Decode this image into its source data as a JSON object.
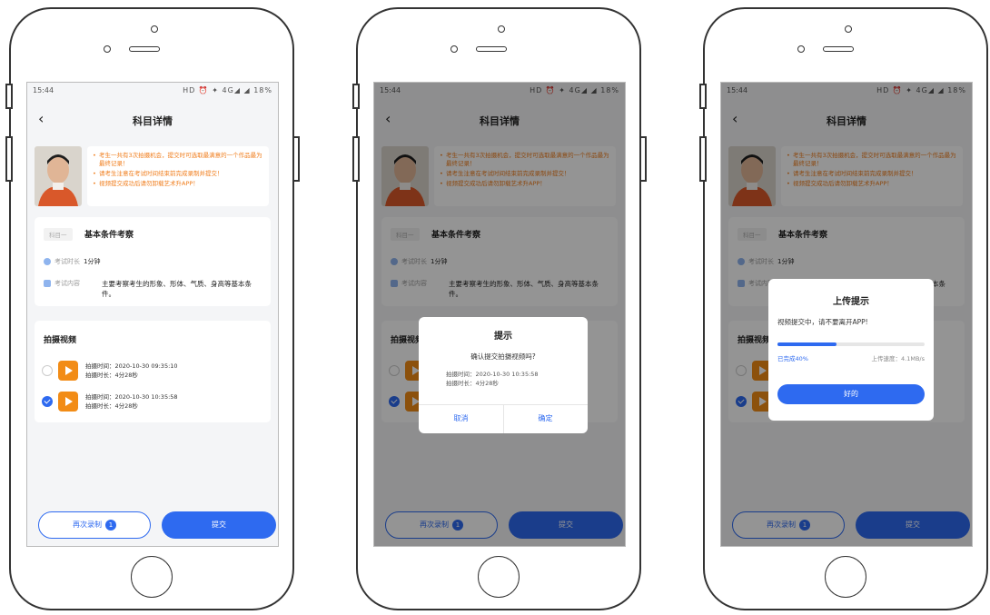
{
  "status": {
    "time": "15:44",
    "icons": "HD ⏰ ✦ 4G◢ ◢ 18%",
    "battery": "18%"
  },
  "nav": {
    "title": "科目详情"
  },
  "notices": [
    "考生一共有3次拍摄机会，提交时可选取最满意的一个作品最为最终记录！",
    "请考生注意在考试时间结束前完成录制并提交！",
    "视频提交成功后请勿卸载艺术升APP！"
  ],
  "subject": {
    "tag": "科目一",
    "name": "基本条件考察",
    "duration_label": "考试时长",
    "duration_value": "1分钟",
    "content_label": "考试内容",
    "content_value": "主要考察考生的形象、形体、气质、身高等基本条件。"
  },
  "videos": {
    "heading": "拍摄视频",
    "items": [
      {
        "time": "拍摄时间：2020-10-30 09:35:10",
        "length": "拍摄时长：4分28秒",
        "selected": false
      },
      {
        "time": "拍摄时间：2020-10-30 10:35:58",
        "length": "拍摄时长：4分28秒",
        "selected": true
      }
    ]
  },
  "actions": {
    "rerecord": "再次录制",
    "rerecord_count": "1",
    "submit": "提交"
  },
  "confirm_dialog": {
    "title": "提示",
    "message": "确认提交拍摄视频吗?",
    "time": "拍摄时间：2020-10-30 10:35:58",
    "length": "拍摄时长：4分28秒",
    "cancel": "取消",
    "ok": "确定"
  },
  "upload_dialog": {
    "title": "上传提示",
    "message": "视频提交中，请不要离开APP!",
    "progress_label": "已完成40%",
    "progress": 0.4,
    "speed": "上传速度：4.1MB/s",
    "ok": "好的"
  },
  "colors": {
    "accent": "#2e6af0",
    "warning": "#f07c1a",
    "play": "#f28c16"
  }
}
